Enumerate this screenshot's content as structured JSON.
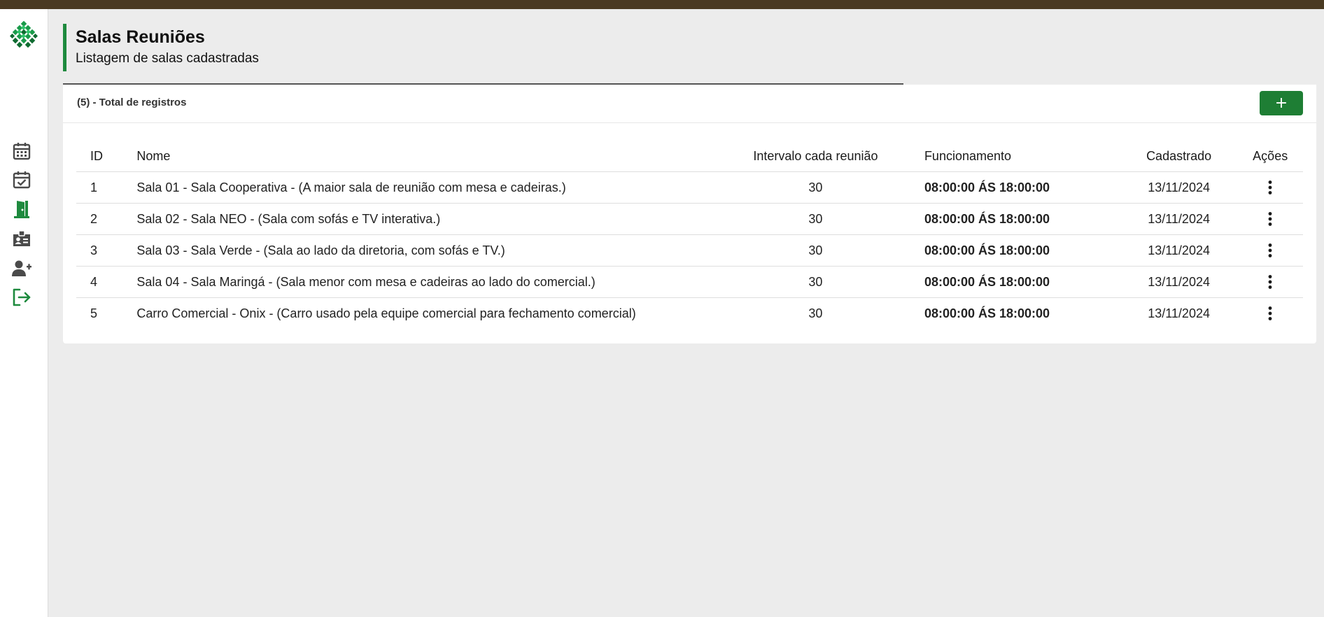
{
  "page": {
    "title": "Salas Reuniões",
    "subtitle": "Listagem de salas cadastradas"
  },
  "theme": {
    "accent": "#1e8a3e",
    "topbar": "#4a3a22",
    "button": "#1e7e34"
  },
  "sidebar": {
    "logo": "green-diamond-logo",
    "items": [
      {
        "icon": "calendar-icon",
        "active": false
      },
      {
        "icon": "calendar-check-icon",
        "active": false
      },
      {
        "icon": "door-icon",
        "active": true
      },
      {
        "icon": "id-badge-icon",
        "active": false
      },
      {
        "icon": "user-plus-icon",
        "active": false
      },
      {
        "icon": "logout-icon",
        "active": false
      }
    ]
  },
  "card": {
    "total_label": "(5) - Total de registros",
    "add_label": "+"
  },
  "table": {
    "columns": {
      "id": "ID",
      "nome": "Nome",
      "intervalo": "Intervalo cada reunião",
      "funcionamento": "Funcionamento",
      "cadastrado": "Cadastrado",
      "acoes": "Ações"
    },
    "rows": [
      {
        "id": "1",
        "nome": "Sala 01 - Sala Cooperativa - (A maior sala de reunião com mesa e cadeiras.)",
        "intervalo": "30",
        "funcionamento": "08:00:00 ÁS 18:00:00",
        "cadastrado": "13/11/2024"
      },
      {
        "id": "2",
        "nome": "Sala 02 - Sala NEO - (Sala com sofás e TV interativa.)",
        "intervalo": "30",
        "funcionamento": "08:00:00 ÁS 18:00:00",
        "cadastrado": "13/11/2024"
      },
      {
        "id": "3",
        "nome": "Sala 03 - Sala Verde - (Sala ao lado da diretoria, com sofás e TV.)",
        "intervalo": "30",
        "funcionamento": "08:00:00 ÁS 18:00:00",
        "cadastrado": "13/11/2024"
      },
      {
        "id": "4",
        "nome": "Sala 04 - Sala Maringá - (Sala menor com mesa e cadeiras ao lado do comercial.)",
        "intervalo": "30",
        "funcionamento": "08:00:00 ÁS 18:00:00",
        "cadastrado": "13/11/2024"
      },
      {
        "id": "5",
        "nome": "Carro Comercial - Onix - (Carro usado pela equipe comercial para fechamento comercial)",
        "intervalo": "30",
        "funcionamento": "08:00:00 ÁS 18:00:00",
        "cadastrado": "13/11/2024"
      }
    ]
  }
}
